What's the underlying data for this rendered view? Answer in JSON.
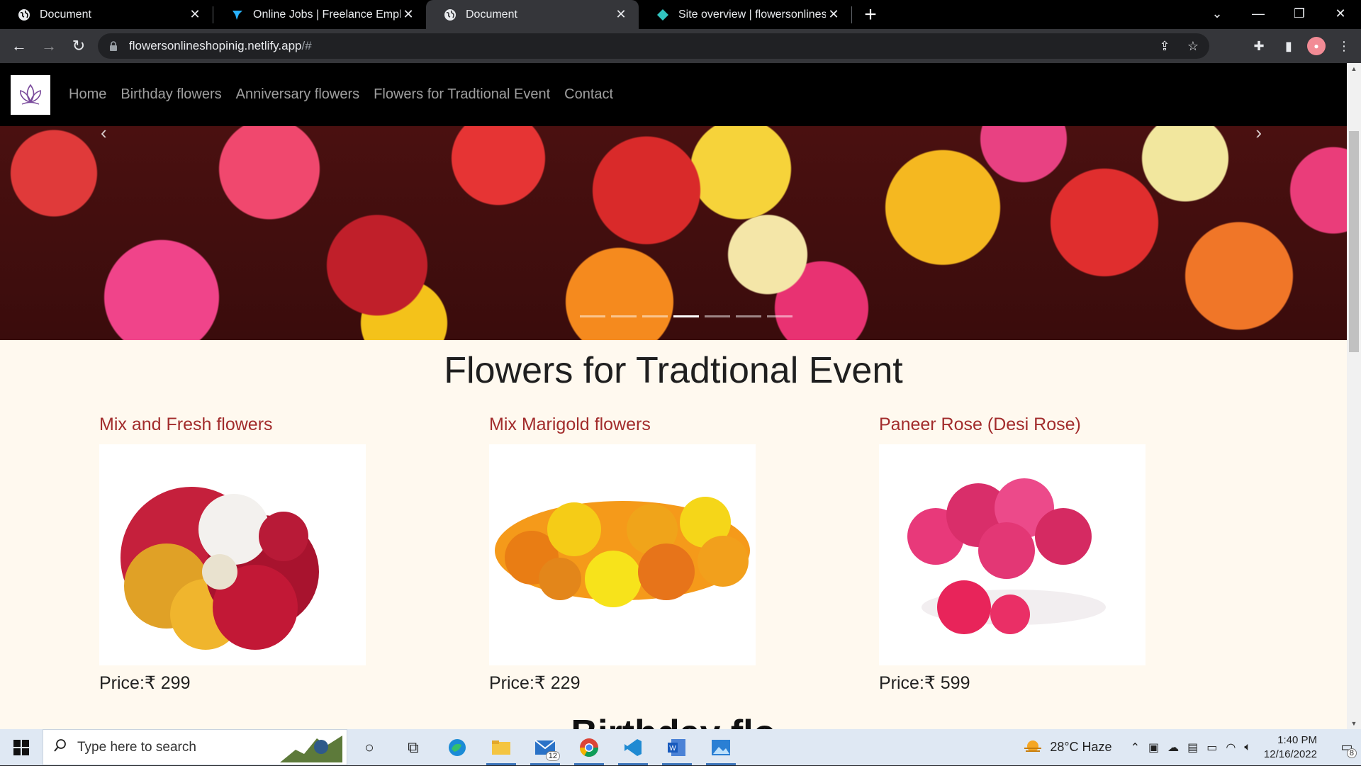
{
  "browser": {
    "tabs": [
      {
        "title": "Document",
        "icon": "globe-icon",
        "active": false
      },
      {
        "title": "Online Jobs | Freelance Employm",
        "icon": "freelancer-icon",
        "active": false
      },
      {
        "title": "Document",
        "icon": "globe-icon",
        "active": true
      },
      {
        "title": "Site overview | flowersonlineshop",
        "icon": "netlify-icon",
        "active": false
      }
    ],
    "url_host": "flowersonlineshopinig.netlify.app",
    "url_rest": "/#"
  },
  "site": {
    "nav": [
      "Home",
      "Birthday flowers",
      "Anniversary flowers",
      "Flowers for Tradtional Event",
      "Contact"
    ],
    "section_title": "Flowers for Tradtional Event",
    "products": [
      {
        "name": "Mix and Fresh flowers",
        "price": "Price:₹ 299"
      },
      {
        "name": "Mix Marigold flowers",
        "price": "Price:₹ 229"
      },
      {
        "name": "Paneer Rose (Desi Rose)",
        "price": "Price:₹ 599"
      }
    ],
    "next_section_title_partial": "Birthday flo",
    "carousel_slide_count": 7,
    "carousel_active_index": 3
  },
  "taskbar": {
    "search_placeholder": "Type here to search",
    "mail_badge": "12",
    "weather": "28°C  Haze",
    "time": "1:40 PM",
    "date": "12/16/2022",
    "notification_count": "8"
  },
  "colors": {
    "page_bg": "#fff9ef",
    "product_title": "#a22c2c",
    "nav_bg": "#000000"
  }
}
